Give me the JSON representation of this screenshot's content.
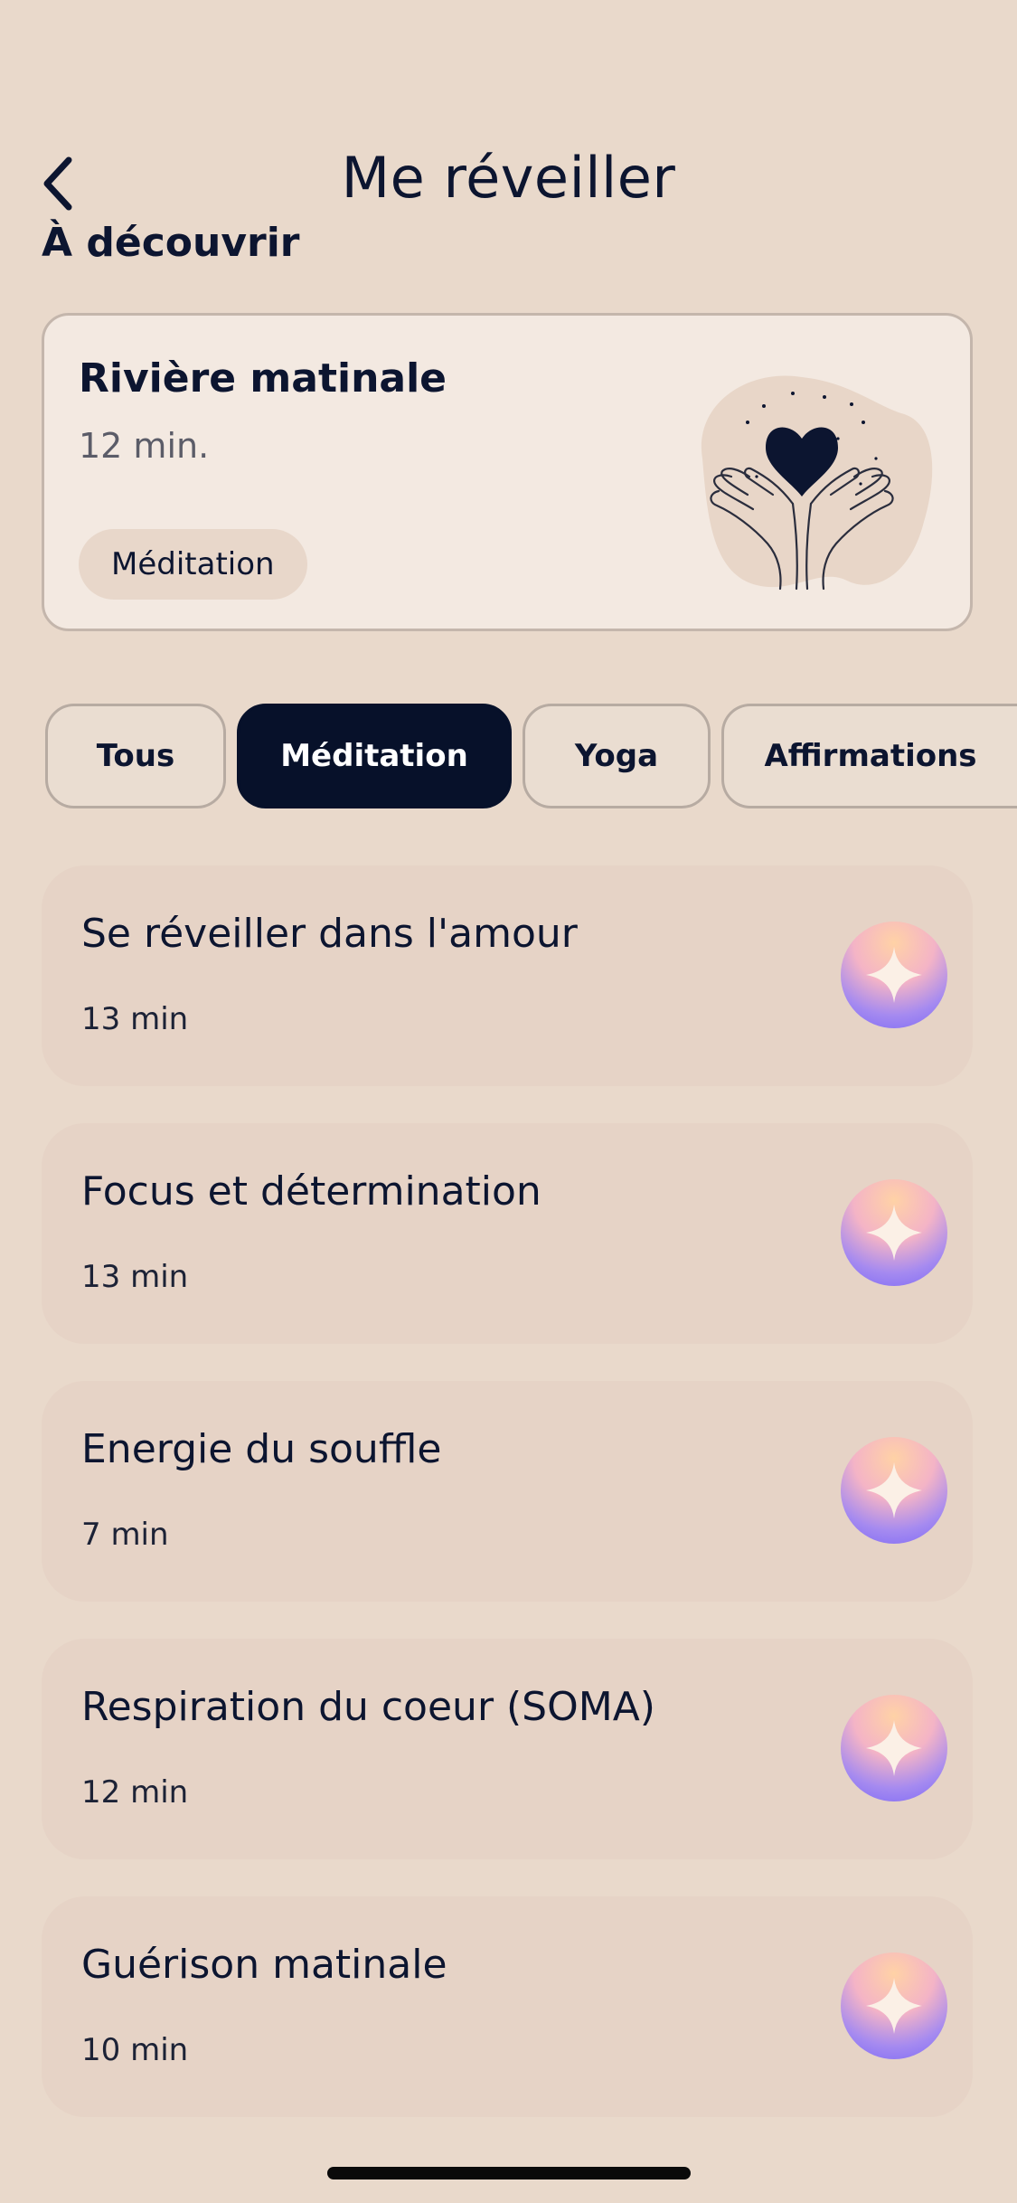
{
  "header": {
    "title": "Me réveiller",
    "back_icon": "chevron-left-icon"
  },
  "discover": {
    "section_title": "À découvrir",
    "featured": {
      "title": "Rivière matinale",
      "duration": "12 min.",
      "tag": "Méditation",
      "illustration": "hands-heart-icon"
    }
  },
  "filters": {
    "chips": [
      {
        "label": "Tous",
        "active": false
      },
      {
        "label": "Méditation",
        "active": true
      },
      {
        "label": "Yoga",
        "active": false
      },
      {
        "label": "Affirmations",
        "active": false
      }
    ]
  },
  "list": {
    "items": [
      {
        "title": "Se réveiller dans l'amour",
        "duration": "13 min"
      },
      {
        "title": "Focus et détermination",
        "duration": "13 min"
      },
      {
        "title": "Energie du souffle",
        "duration": "7 min"
      },
      {
        "title": "Respiration du coeur (SOMA)",
        "duration": "12 min"
      },
      {
        "title": "Guérison matinale",
        "duration": "10 min"
      }
    ],
    "item_icon": "sparkle-icon"
  },
  "colors": {
    "background": "#e9d9cb",
    "text": "#0c1530",
    "active_chip": "#07112a",
    "card": "#e6d3c6"
  }
}
